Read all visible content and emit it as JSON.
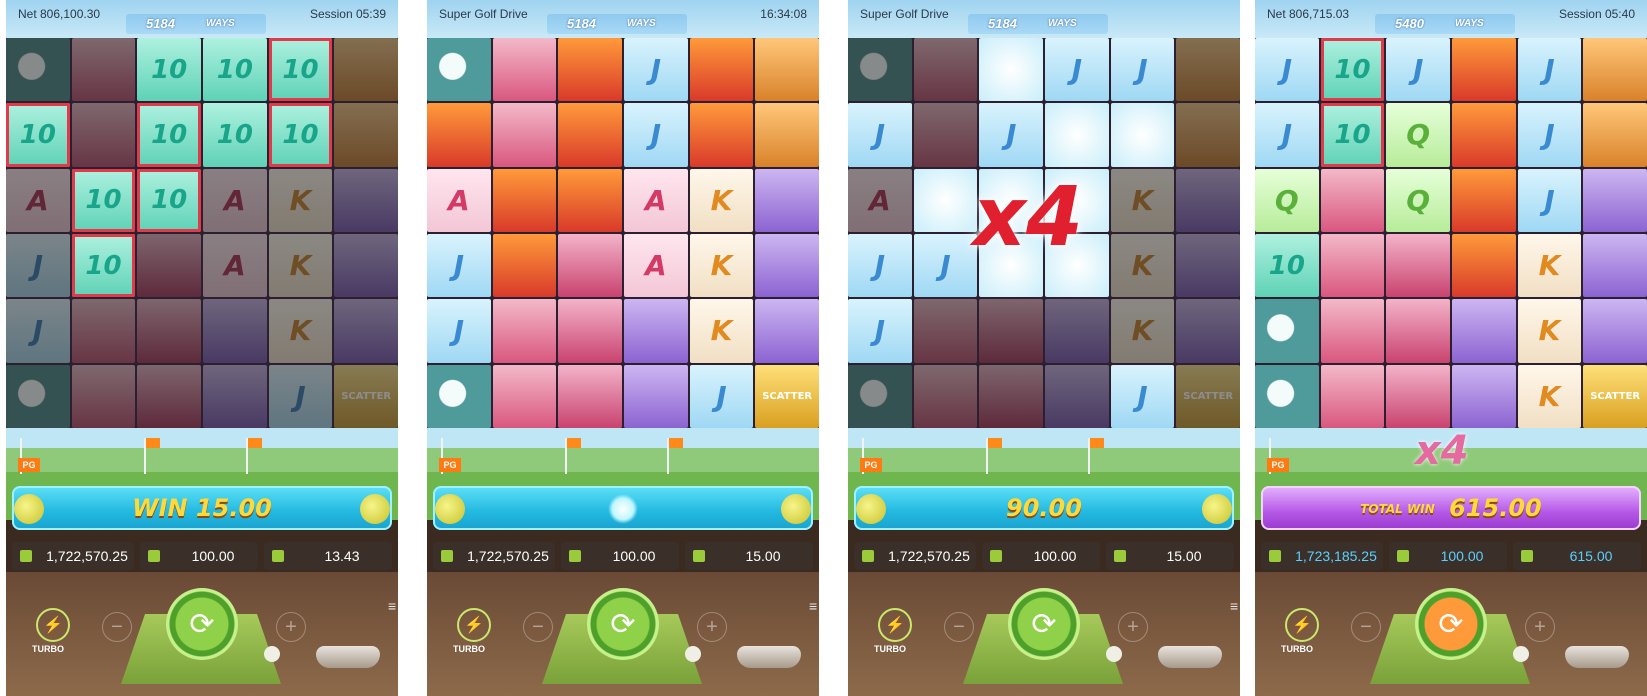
{
  "panels": [
    {
      "top_left": "Net 806,100.30",
      "top_right": "Session 05:39",
      "ways_count": "5184",
      "ways_label": "WAYS",
      "win_label": "WIN",
      "win_value": "15.00",
      "multiplier": "",
      "balance": "1,722,570.25",
      "bet": "100.00",
      "win": "13.43",
      "turbo_label": "TURBO",
      "bar_style": "blue"
    },
    {
      "top_left": "Super Golf Drive",
      "top_right": "16:34:08",
      "ways_count": "5184",
      "ways_label": "WAYS",
      "win_label": "",
      "win_value": "",
      "multiplier": "",
      "balance": "1,722,570.25",
      "bet": "100.00",
      "win": "15.00",
      "turbo_label": "TURBO",
      "bar_style": "blue"
    },
    {
      "top_left": "Super Golf Drive",
      "top_right": "",
      "ways_count": "5184",
      "ways_label": "WAYS",
      "win_label": "",
      "win_value": "90.00",
      "multiplier": "x4",
      "balance": "1,722,570.25",
      "bet": "100.00",
      "win": "15.00",
      "turbo_label": "TURBO",
      "bar_style": "blue"
    },
    {
      "top_left": "Net 806,715.03",
      "top_right": "Session 05:40",
      "ways_count": "5480",
      "ways_label": "WAYS",
      "win_label": "TOTAL WIN",
      "win_value": "615.00",
      "multiplier": "x4",
      "balance": "1,723,185.25",
      "bet": "100.00",
      "win": "615.00",
      "turbo_label": "TURBO",
      "bar_style": "purple"
    }
  ],
  "symbols": {
    "ten": "10",
    "a": "A",
    "j": "J",
    "k": "K",
    "q": "Q",
    "scatter": "SCATTER",
    "flag_logo": "PG"
  },
  "icons": {
    "turbo": "lightning-icon",
    "spin": "spin-arrows-icon",
    "minus": "minus-icon",
    "plus": "plus-icon",
    "menu": "menu-icon",
    "balance": "wallet-icon",
    "bet": "coins-icon",
    "win": "win-icon"
  },
  "colors": {
    "win_text": "#ffd93a",
    "multiplier": "#e0202f",
    "accent_blue": "#5ad0ff"
  }
}
